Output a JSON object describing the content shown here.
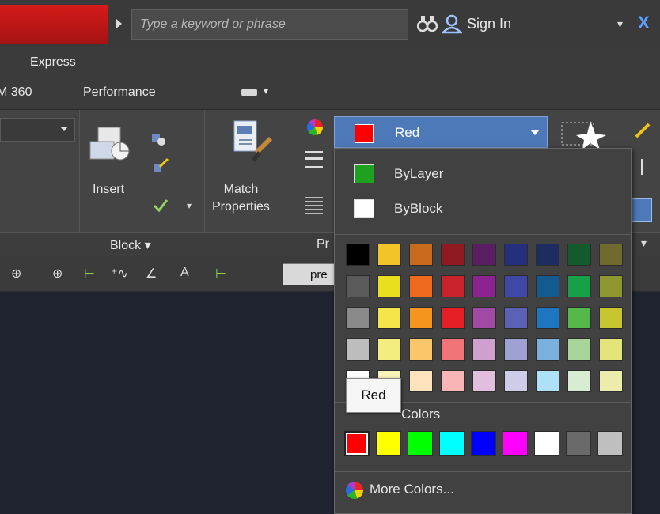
{
  "topbar": {
    "search_placeholder": "Type a keyword or phrase",
    "signin_label": "Sign In",
    "binoculars_icon": "binoculars-icon",
    "user_icon": "user-icon"
  },
  "ribbon": {
    "express_tab": "Express",
    "tab_a360": "M 360",
    "tab_performance": "Performance",
    "insert_label": "Insert",
    "match_properties_label_1": "Match",
    "match_properties_label_2": "Properties",
    "block_panel_label": "Block",
    "properties_panel_label": "Pr",
    "color_combo_value": "Red",
    "color_combo_swatch": "#ff0000"
  },
  "toolbar": {
    "field_text": "pre"
  },
  "dropdown": {
    "bylayer_label": "ByLayer",
    "bylayer_color": "#1fa01f",
    "byblock_label": "ByBlock",
    "byblock_color": "#ffffff",
    "index_rows": [
      [
        "#000000",
        "#f2c427",
        "#c86a1e",
        "#8f1a1f",
        "#5a1e62",
        "#262f7e",
        "#1e2c62",
        "#135a2d",
        "#6f6a2e"
      ],
      [
        "#5a5a5a",
        "#eadf1e",
        "#f06a1d",
        "#c8222a",
        "#8d2291",
        "#3f48a7",
        "#125a8f",
        "#16a047",
        "#8f9730"
      ],
      [
        "#8a8a8a",
        "#f3e54a",
        "#f6951e",
        "#e61f26",
        "#a04aa6",
        "#5b62b6",
        "#1f76c0",
        "#55b84a",
        "#c7c62e"
      ],
      [
        "#bdbdbd",
        "#f3ed7f",
        "#fbc56a",
        "#f07478",
        "#cfa0cd",
        "#9ea1d2",
        "#79b0de",
        "#a7d59a",
        "#e3e479"
      ],
      [
        "#ffffff",
        "#f8f3b7",
        "#fde3bd",
        "#f9b4b6",
        "#e1bedd",
        "#cdcdea",
        "#aee0f7",
        "#d8ecd3",
        "#ecedac"
      ]
    ],
    "standard_label": "Colors",
    "standard_colors": [
      "#ff0000",
      "#ffff00",
      "#00ff00",
      "#00ffff",
      "#0000ff",
      "#ff00ff",
      "#ffffff",
      "#6a6a6a",
      "#bfbfbf"
    ],
    "selected_standard_index": 0,
    "more_colors_label": "More Colors..."
  },
  "tooltip": {
    "text": "Red"
  }
}
